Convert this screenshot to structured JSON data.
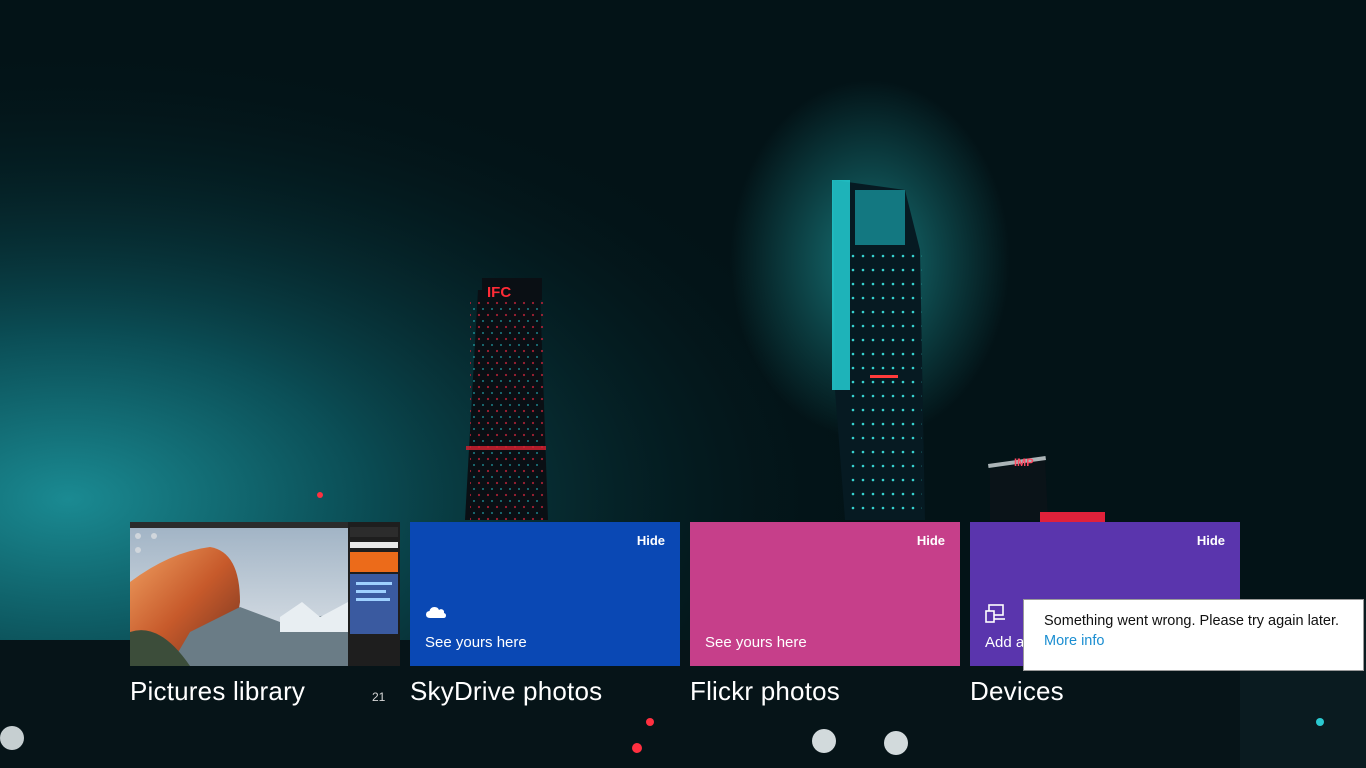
{
  "tiles": [
    {
      "caption": "Pictures library",
      "count": "21"
    },
    {
      "caption": "SkyDrive photos",
      "hide_label": "Hide",
      "body_text": "See yours here",
      "icon": "cloud-icon",
      "color": "#0a48b4"
    },
    {
      "caption": "Flickr photos",
      "hide_label": "Hide",
      "body_text": "See yours here",
      "color": "#c63f8a"
    },
    {
      "caption": "Devices",
      "hide_label": "Hide",
      "body_text": "Add a",
      "icon": "devices-icon",
      "color": "#5a35ad"
    }
  ],
  "toast": {
    "message": "Something went wrong. Please try again later.",
    "link": "More info"
  },
  "background": {
    "building_signs": [
      "IFC",
      "IMP"
    ]
  },
  "colors": {
    "skydrive": "#0a48b4",
    "flickr": "#c63f8a",
    "devices": "#5a35ad",
    "link": "#1b8ed1"
  }
}
